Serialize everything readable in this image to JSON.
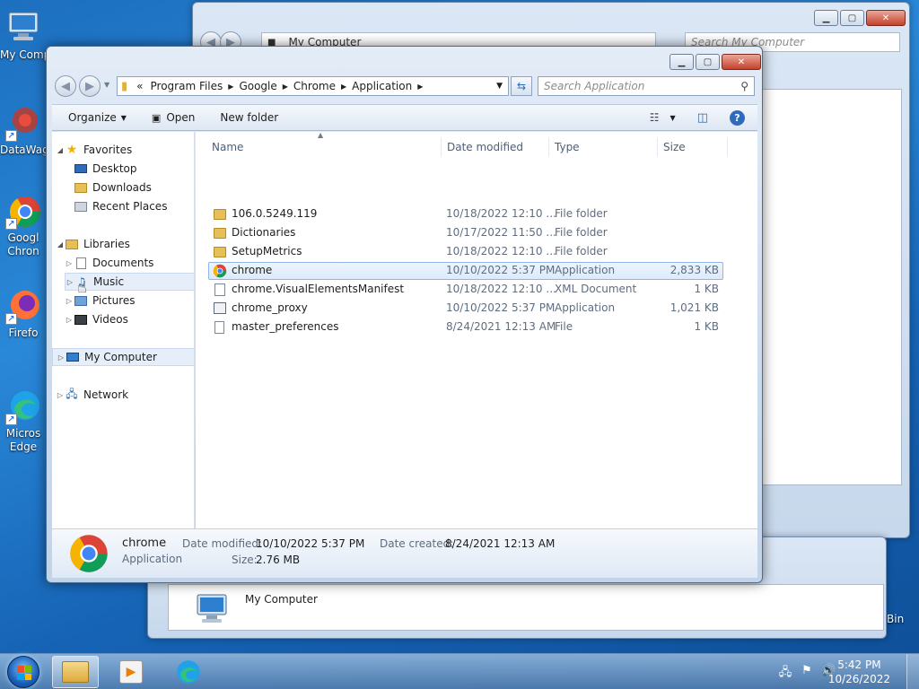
{
  "desktop": {
    "icons": [
      {
        "label": "My Comp"
      },
      {
        "label": "DataWag"
      },
      {
        "label": "Googl"
      },
      {
        "label": "Chron"
      },
      {
        "label": "Firefo"
      },
      {
        "label": "Micros"
      },
      {
        "label": "Edge"
      }
    ],
    "recycle_bin_label": "Bin"
  },
  "back_window": {
    "address": "My Computer",
    "search_placeholder": "Search My Computer"
  },
  "lower_window": {
    "item_label": "My Computer"
  },
  "explorer": {
    "breadcrumb_overflow": "«",
    "breadcrumbs": [
      "Program Files",
      "Google",
      "Chrome",
      "Application"
    ],
    "search_placeholder": "Search Application",
    "toolbar": {
      "organize": "Organize",
      "open": "Open",
      "new_folder": "New folder"
    },
    "nav": {
      "favorites": "Favorites",
      "desktop": "Desktop",
      "downloads": "Downloads",
      "recent_places": "Recent Places",
      "libraries": "Libraries",
      "documents": "Documents",
      "music": "Music",
      "pictures": "Pictures",
      "videos": "Videos",
      "my_computer": "My Computer",
      "network": "Network"
    },
    "columns": {
      "name": "Name",
      "date_modified": "Date modified",
      "type": "Type",
      "size": "Size"
    },
    "files": [
      {
        "name": "106.0.5249.119",
        "date": "10/18/2022 12:10 ...",
        "type": "File folder",
        "size": "",
        "icon": "folder-icon"
      },
      {
        "name": "Dictionaries",
        "date": "10/17/2022 11:50 ...",
        "type": "File folder",
        "size": "",
        "icon": "folder-icon"
      },
      {
        "name": "SetupMetrics",
        "date": "10/18/2022 12:10 ...",
        "type": "File folder",
        "size": "",
        "icon": "folder-icon"
      },
      {
        "name": "chrome",
        "date": "10/10/2022 5:37 PM",
        "type": "Application",
        "size": "2,833 KB",
        "icon": "chrome-icon"
      },
      {
        "name": "chrome.VisualElementsManifest",
        "date": "10/18/2022 12:10 ...",
        "type": "XML Document",
        "size": "1 KB",
        "icon": "xml-file-icon"
      },
      {
        "name": "chrome_proxy",
        "date": "10/10/2022 5:37 PM",
        "type": "Application",
        "size": "1,021 KB",
        "icon": "app-icon"
      },
      {
        "name": "master_preferences",
        "date": "8/24/2021 12:13 AM",
        "type": "File",
        "size": "1 KB",
        "icon": "file-icon"
      }
    ],
    "details": {
      "name": "chrome",
      "type": "Application",
      "date_modified_label": "Date modified:",
      "date_modified": "10/10/2022 5:37 PM",
      "date_created_label": "Date created:",
      "date_created": "8/24/2021 12:13 AM",
      "size_label": "Size:",
      "size": "2.76 MB"
    }
  },
  "taskbar": {
    "time": "5:42 PM",
    "date": "10/26/2022"
  },
  "colors": {
    "selection_border": "#8fb6e6",
    "selection_fill": "#dceafb",
    "close_button": "#c4412b"
  }
}
